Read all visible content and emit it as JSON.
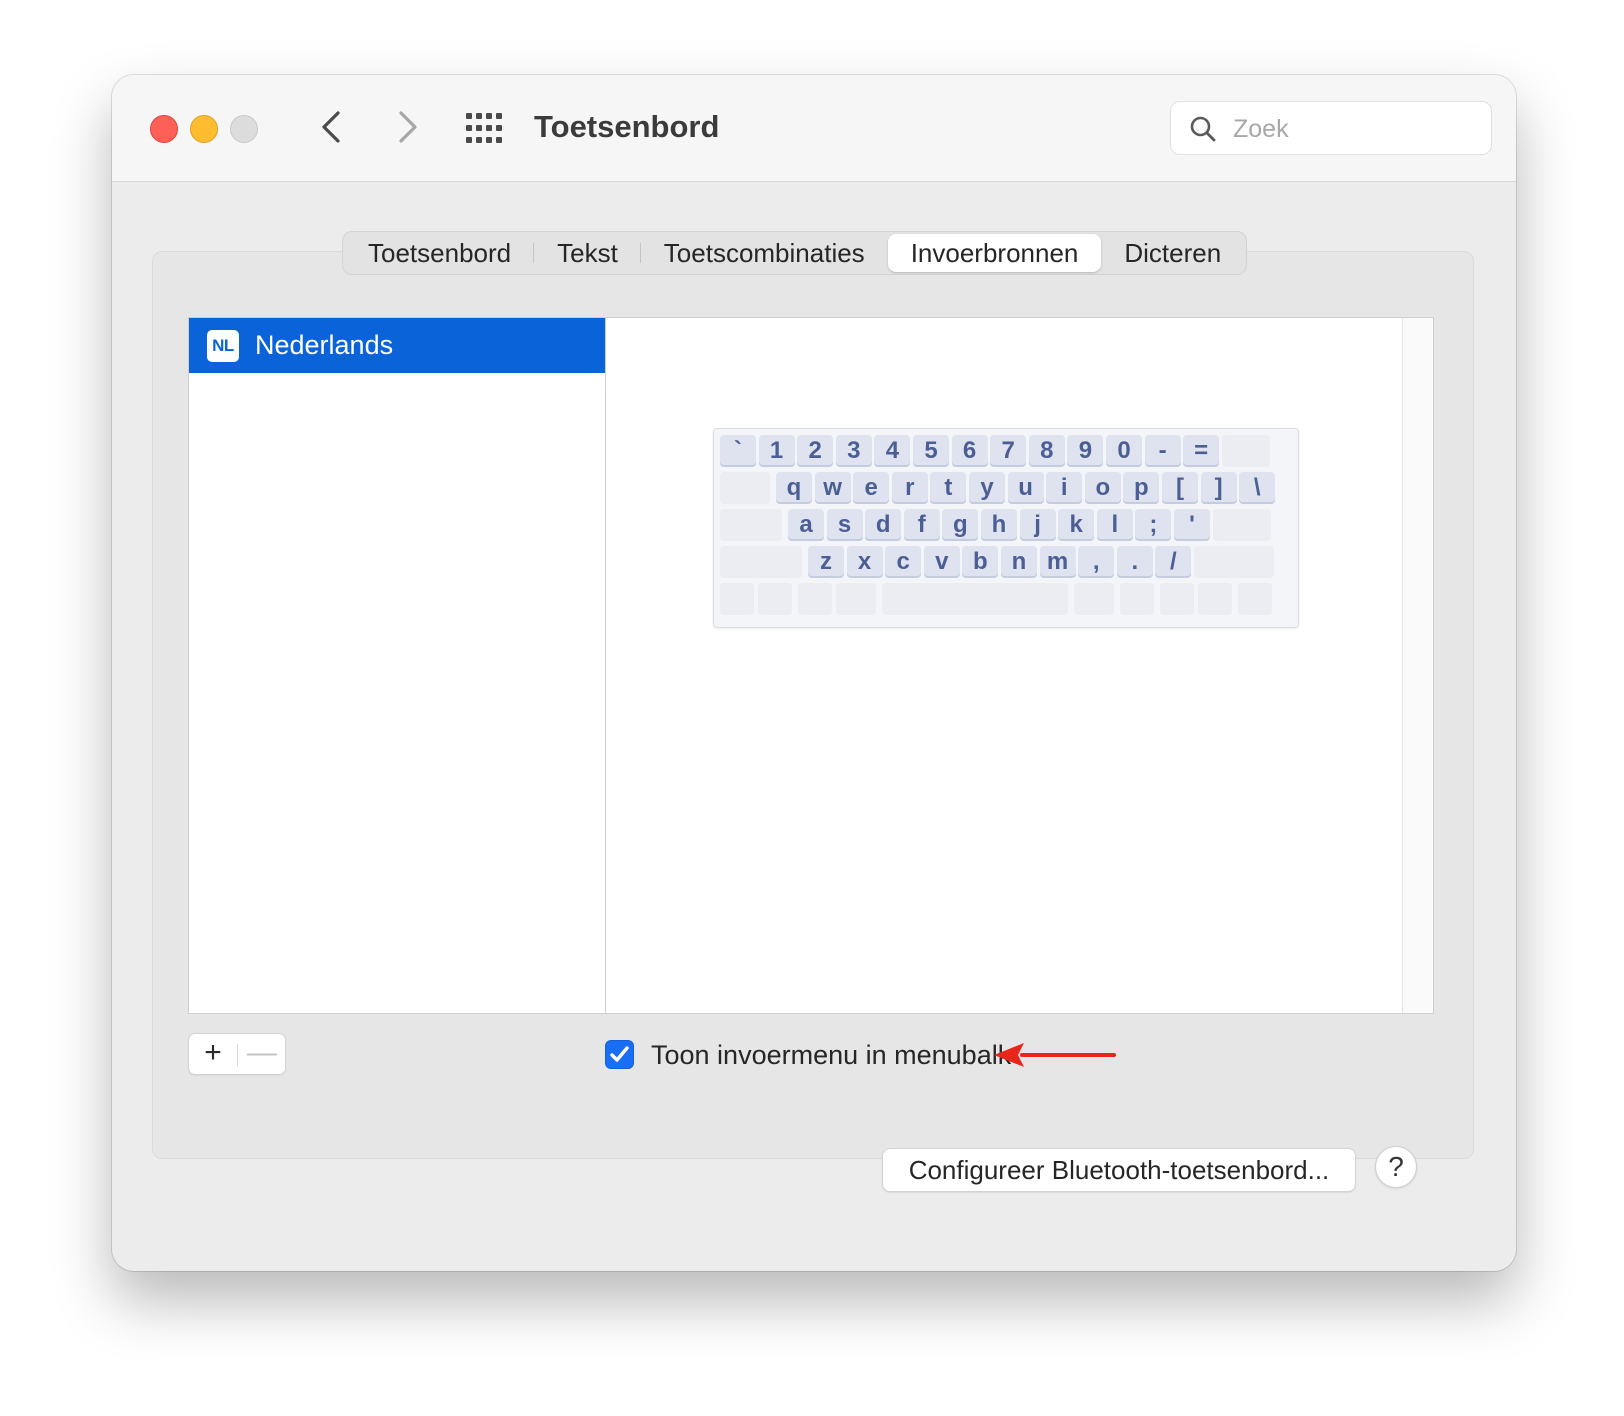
{
  "window": {
    "title": "Toetsenbord",
    "search_placeholder": "Zoek"
  },
  "tabs": [
    {
      "label": "Toetsenbord",
      "active": false
    },
    {
      "label": "Tekst",
      "active": false
    },
    {
      "label": "Toetscombinaties",
      "active": false
    },
    {
      "label": "Invoerbronnen",
      "active": true
    },
    {
      "label": "Dicteren",
      "active": false
    }
  ],
  "input_sources": [
    {
      "badge": "NL",
      "label": "Nederlands",
      "selected": true
    }
  ],
  "keyboard_layout": {
    "row1": [
      "`",
      "1",
      "2",
      "3",
      "4",
      "5",
      "6",
      "7",
      "8",
      "9",
      "0",
      "-",
      "="
    ],
    "row2": [
      "q",
      "w",
      "e",
      "r",
      "t",
      "y",
      "u",
      "i",
      "o",
      "p",
      "[",
      "]",
      "\\"
    ],
    "row3": [
      "a",
      "s",
      "d",
      "f",
      "g",
      "h",
      "j",
      "k",
      "l",
      ";",
      "'"
    ],
    "row4": [
      "z",
      "x",
      "c",
      "v",
      "b",
      "n",
      "m",
      ",",
      ".",
      "/"
    ]
  },
  "list_buttons": {
    "add": "+",
    "remove": "—"
  },
  "show_input_menu": {
    "label": "Toon invoermenu in menubalk",
    "checked": true
  },
  "footer": {
    "bluetooth_button": "Configureer Bluetooth-toetsenbord...",
    "help_button": "?"
  },
  "colors": {
    "selection": "#0a63d9",
    "checkbox": "#1a6ef5",
    "annotation_arrow": "#e8261c",
    "key_text": "#4c5f94"
  }
}
